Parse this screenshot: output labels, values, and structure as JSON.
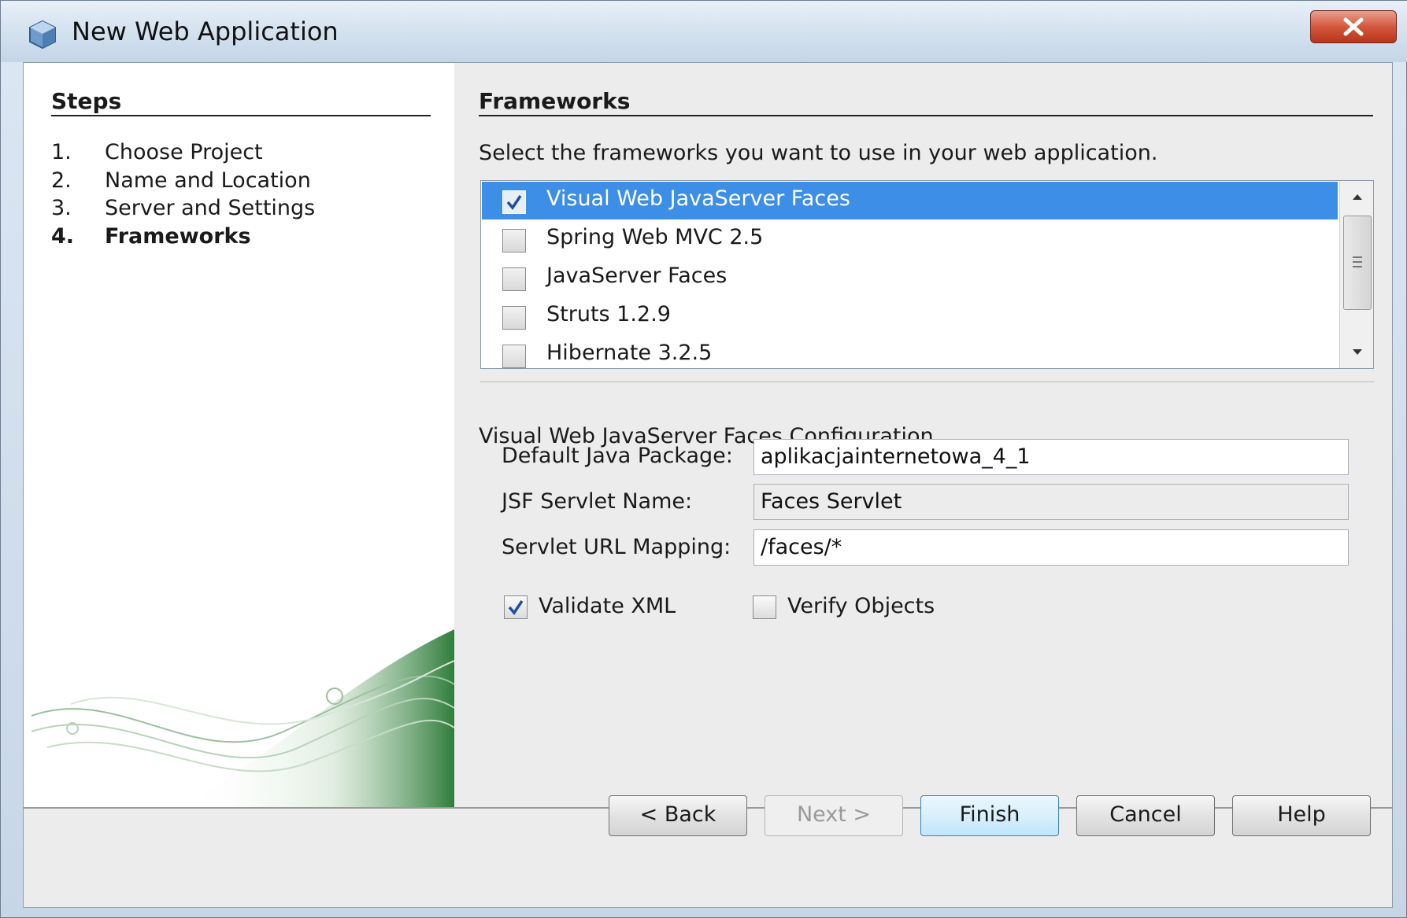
{
  "window": {
    "title": "New Web Application"
  },
  "steps": {
    "title": "Steps",
    "items": [
      {
        "num": "1.",
        "label": "Choose Project"
      },
      {
        "num": "2.",
        "label": "Name and Location"
      },
      {
        "num": "3.",
        "label": "Server and Settings"
      },
      {
        "num": "4.",
        "label": "Frameworks",
        "active": true
      }
    ]
  },
  "frameworks": {
    "title": "Frameworks",
    "instruction": "Select the frameworks you want to use in your web application.",
    "list": [
      {
        "name": "Visual Web JavaServer Faces",
        "checked": true,
        "selected": true
      },
      {
        "name": "Spring Web MVC 2.5",
        "checked": false
      },
      {
        "name": "JavaServer Faces",
        "checked": false
      },
      {
        "name": "Struts 1.2.9",
        "checked": false
      },
      {
        "name": "Hibernate 3.2.5",
        "checked": false
      }
    ]
  },
  "config": {
    "title": "Visual Web JavaServer Faces Configuration",
    "default_package_label": "Default Java Package:",
    "default_package_value": "aplikacjainternetowa_4_1",
    "servlet_name_label": "JSF Servlet Name:",
    "servlet_name_value": "Faces Servlet",
    "url_mapping_label": "Servlet URL Mapping:",
    "url_mapping_value": "/faces/*",
    "validate_xml_label": "Validate XML",
    "validate_xml_checked": true,
    "verify_objects_label": "Verify Objects",
    "verify_objects_checked": false
  },
  "buttons": {
    "back": "< Back",
    "next": "Next >",
    "finish": "Finish",
    "cancel": "Cancel",
    "help": "Help"
  },
  "colors": {
    "selection": "#3d8ee6",
    "close_button": "#d4583d"
  }
}
